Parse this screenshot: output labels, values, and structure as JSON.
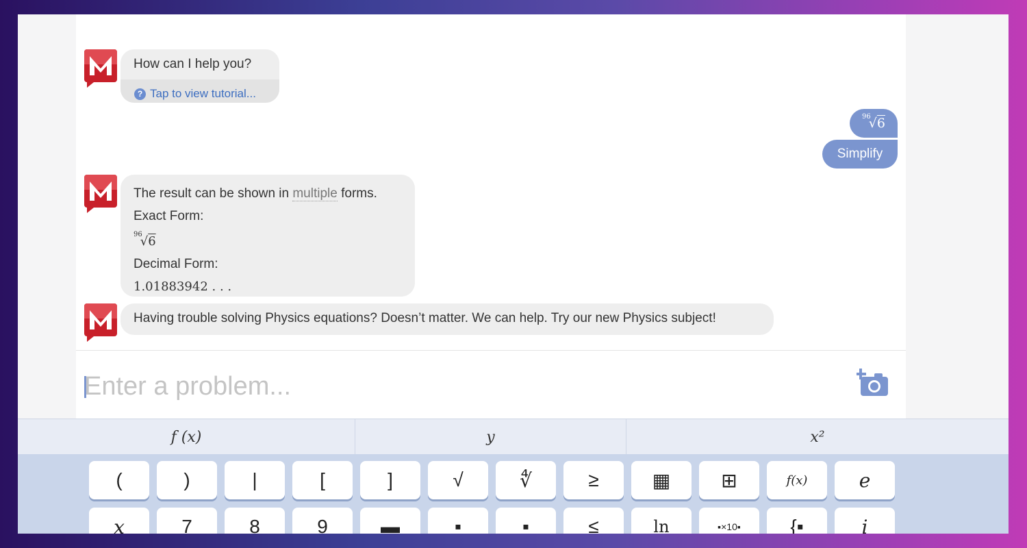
{
  "chat": {
    "greeting": "How can I help you?",
    "tutorial_link": "Tap to view tutorial...",
    "tutorial_icon": "?",
    "user_expression": {
      "index": "96",
      "radicand": "6"
    },
    "user_action": "Simplify",
    "result_intro_before": "The result can be shown in ",
    "result_intro_link": "multiple",
    "result_intro_after": " forms.",
    "exact_label": "Exact Form:",
    "exact_value": {
      "index": "96",
      "radicand": "6"
    },
    "decimal_label": "Decimal Form:",
    "decimal_value": "1.01883942 . . .",
    "promo": "Having trouble solving Physics equations? Doesn’t matter. We can help. Try our new Physics subject!"
  },
  "input": {
    "placeholder": "Enter a problem..."
  },
  "keyboard": {
    "tabs": [
      "f (x)",
      "y",
      "x²"
    ],
    "row1": [
      "(",
      ")",
      "|",
      "[",
      "]",
      "√",
      "∜",
      "≥",
      "▦",
      "⊞",
      "f(x)",
      "e"
    ],
    "row2": [
      "x",
      "7",
      "8",
      "9",
      "▬",
      "▪",
      "▪",
      "≤",
      "ln",
      "▪×10▪",
      "{▪",
      "i"
    ]
  },
  "colors": {
    "user_bubble": "#7b95cf",
    "bot_bubble": "#eeeeee",
    "brand_red": "#c8202a",
    "link": "#3d6ec0"
  }
}
